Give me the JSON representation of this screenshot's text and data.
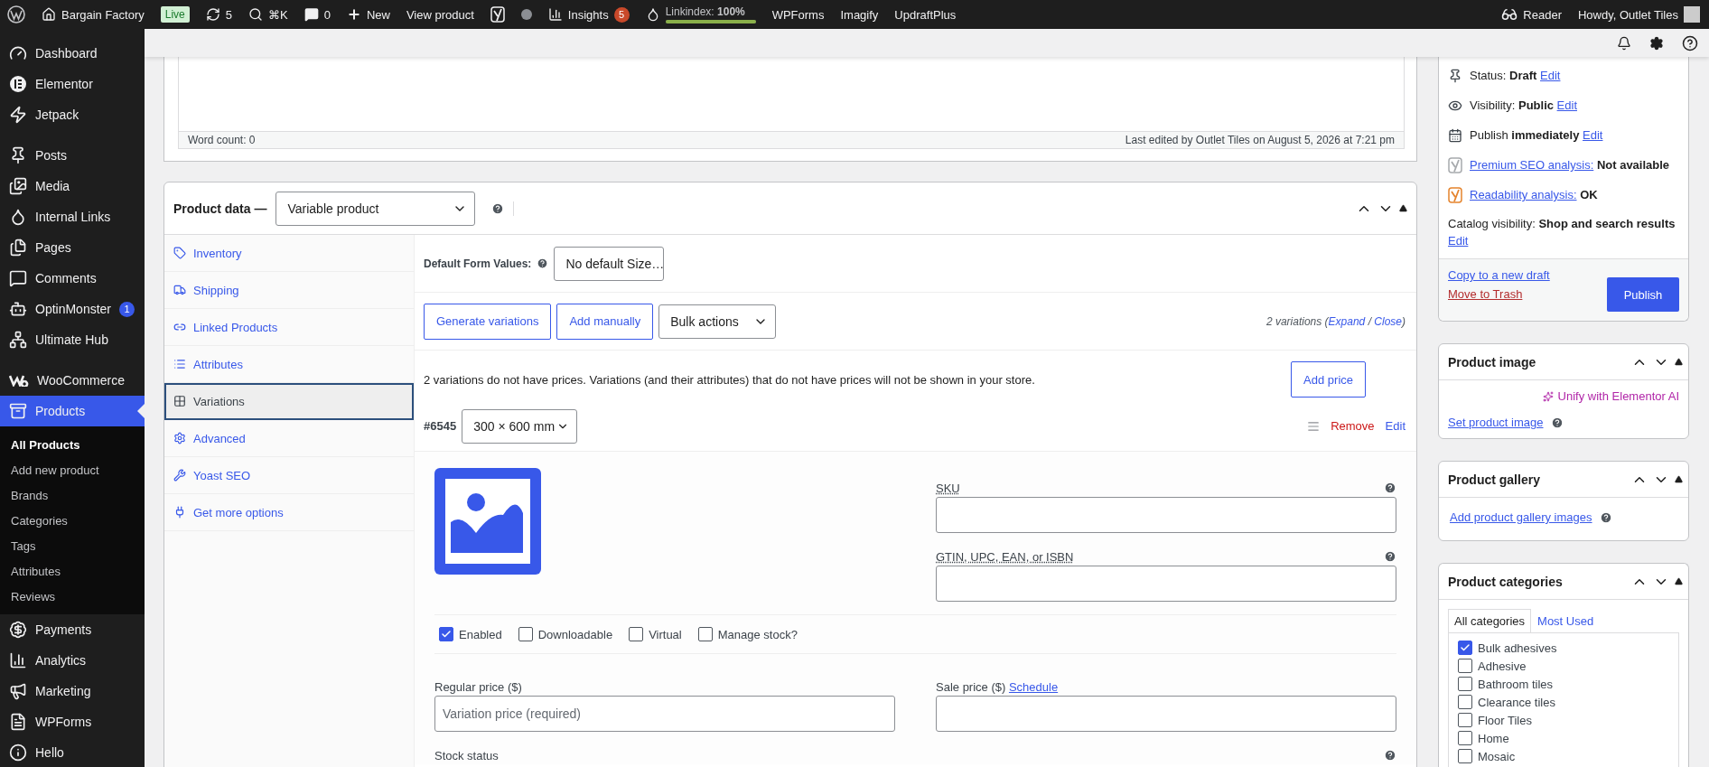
{
  "admin_bar": {
    "site": "Bargain Factory",
    "live_badge": "Live",
    "updates": "5",
    "search_shortcut": "⌘K",
    "comments": "0",
    "new": "New",
    "view_product": "View product",
    "insights": "Insights",
    "insights_count": "5",
    "linkindex": "Linkindex: **100%**",
    "linkindex_meter": {
      "level": 1
    },
    "plugins": [
      "WPForms",
      "Imagify",
      "UpdraftPlus"
    ],
    "reader": "Reader",
    "greeting": "Howdy, Outlet Tiles"
  },
  "sidebar": {
    "sections": [
      [
        {
          "label": "Dashboard",
          "selected": false
        },
        {
          "label": "Elementor",
          "selected": false
        },
        {
          "label": "Jetpack",
          "selected": false
        }
      ],
      [
        {
          "label": "Posts",
          "selected": false
        },
        {
          "label": "Media",
          "selected": false
        },
        {
          "label": "Internal Links",
          "selected": false
        },
        {
          "label": "Pages",
          "selected": false
        },
        {
          "label": "Comments",
          "selected": false
        },
        {
          "label": "OptinMonster",
          "selected": false,
          "badge": "1"
        },
        {
          "label": "Ultimate Hub",
          "selected": false
        }
      ],
      [
        {
          "label": "WooCommerce",
          "selected": false
        },
        {
          "label": "Products",
          "selected": true,
          "submenu": [
            {
              "label": "All Products",
              "selected": true
            },
            {
              "label": "Add new product",
              "selected": false
            },
            {
              "label": "Brands",
              "selected": false
            },
            {
              "label": "Categories",
              "selected": false
            },
            {
              "label": "Tags",
              "selected": false
            },
            {
              "label": "Attributes",
              "selected": false
            },
            {
              "label": "Reviews",
              "selected": false
            }
          ]
        },
        {
          "label": "Payments",
          "selected": false
        },
        {
          "label": "Analytics",
          "selected": false
        },
        {
          "label": "Marketing",
          "selected": false
        },
        {
          "label": "WPForms",
          "selected": false
        },
        {
          "label": "Hello",
          "selected": false
        }
      ]
    ]
  },
  "editor": {
    "word_count": "Word count: 0",
    "last_edited": "Last edited by Outlet Tiles on August 5, 2026 at 7:21 pm"
  },
  "product_data": {
    "title": "Product data —",
    "type": "Variable product",
    "tabs": [
      {
        "label": "Inventory",
        "selected": false
      },
      {
        "label": "Shipping",
        "selected": false
      },
      {
        "label": "Linked Products",
        "selected": false
      },
      {
        "label": "Attributes",
        "selected": false
      },
      {
        "label": "Variations",
        "selected": true
      },
      {
        "label": "Advanced",
        "selected": false
      },
      {
        "label": "Yoast SEO",
        "selected": false
      },
      {
        "label": "Get more options",
        "selected": false
      }
    ],
    "default_form_label": "Default Form Values:",
    "default_form_value": "No default Size…",
    "buttons": [
      "Generate variations",
      "Add manually"
    ],
    "bulk_actions": "Bulk actions",
    "variations_summary": [
      {
        "kind": "text",
        "text": "2 variations ("
      },
      {
        "kind": "link",
        "text": "Expand"
      },
      {
        "kind": "text",
        "text": " / "
      },
      {
        "kind": "link",
        "text": "Close"
      },
      {
        "kind": "text",
        "text": ")"
      }
    ],
    "notice": "2 variations do not have prices. Variations (and their attributes) that do not have prices will not be shown in your store.",
    "add_price": "Add price",
    "variation": {
      "id": "#6545",
      "size": "300 × 600 mm",
      "remove": "Remove",
      "edit": "Edit",
      "sku_label": "SKU",
      "gtin_label": "GTIN, UPC, EAN, or ISBN",
      "options": [
        {
          "label": "Enabled",
          "checked": true
        },
        {
          "label": "Downloadable",
          "checked": false
        },
        {
          "label": "Virtual",
          "checked": false
        },
        {
          "label": "Manage stock?",
          "checked": false
        }
      ],
      "regular_price_label": "Regular price ($)",
      "regular_price_placeholder": "Variation price (required)",
      "sale_price_label": "Sale price ($)",
      "schedule": "Schedule",
      "stock_status_label": "Stock status"
    }
  },
  "publish_box": {
    "rows": [
      {
        "kind": "status",
        "label": "Status:",
        "value": "Draft",
        "link": "Edit"
      },
      {
        "kind": "visibility",
        "label": "Visibility:",
        "value": "Public",
        "link": "Edit"
      },
      {
        "kind": "schedule",
        "label": "Publish",
        "value": "immediately",
        "link": "Edit"
      },
      {
        "kind": "seo",
        "link": "Premium SEO analysis:",
        "value": "Not available"
      },
      {
        "kind": "readability",
        "link": "Readability analysis:",
        "value": "OK"
      },
      {
        "kind": "catalog",
        "label": "Catalog visibility:",
        "value": "Shop and search results",
        "link": "Edit"
      }
    ],
    "copy": "Copy to a new draft",
    "trash": "Move to Trash",
    "publish": "Publish"
  },
  "product_image": {
    "title": "Product image",
    "ai_link": "Unify with Elementor AI",
    "set_link": "Set product image"
  },
  "product_gallery": {
    "title": "Product gallery",
    "add_link": "Add product gallery images"
  },
  "product_categories": {
    "title": "Product categories",
    "tabs": [
      {
        "label": "All categories",
        "selected": true
      },
      {
        "label": "Most Used",
        "selected": false
      }
    ],
    "items": [
      {
        "label": "Bulk adhesives",
        "checked": true
      },
      {
        "label": "Adhesive",
        "checked": false
      },
      {
        "label": "Bathroom tiles",
        "checked": false
      },
      {
        "label": "Clearance tiles",
        "checked": false
      },
      {
        "label": "Floor Tiles",
        "checked": false
      },
      {
        "label": "Home",
        "checked": false
      },
      {
        "label": "Mosaic",
        "checked": false
      }
    ]
  }
}
